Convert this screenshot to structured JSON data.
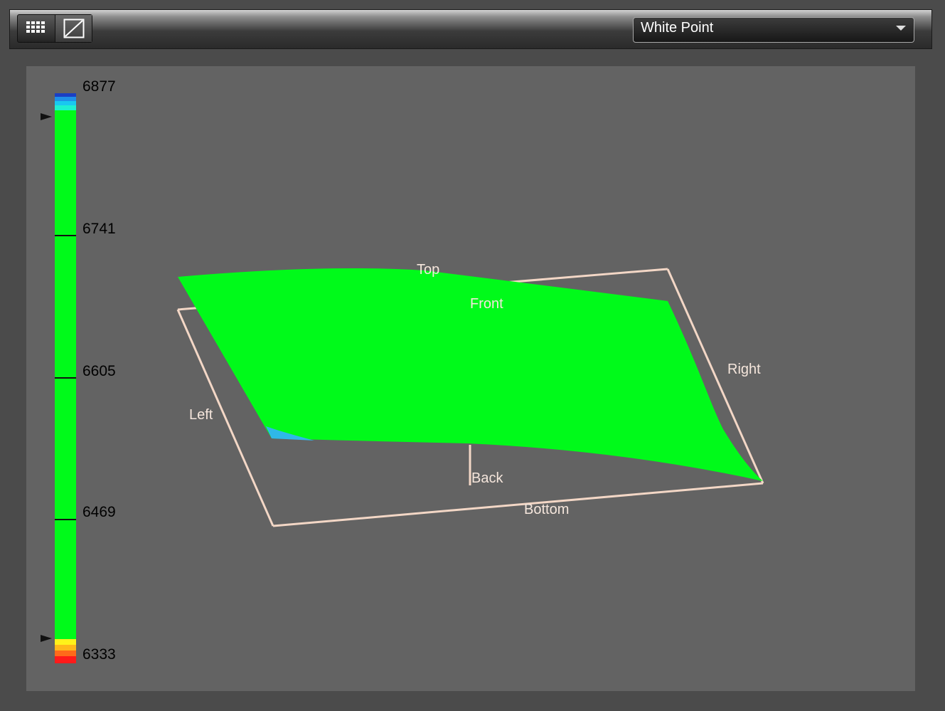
{
  "toolbar": {
    "view_buttons": [
      {
        "name": "grid-view",
        "icon": "grid-icon",
        "active": false
      },
      {
        "name": "curve-view",
        "icon": "diagonal-curve-icon",
        "active": true
      }
    ],
    "dropdown": {
      "selected": "White Point",
      "icon": "chevron-down-icon"
    }
  },
  "colorbar": {
    "labels": [
      "6877",
      "6741",
      "6605",
      "6469",
      "6333"
    ],
    "range": [
      6333,
      6877
    ],
    "colors": {
      "high": [
        "#1a3fc4",
        "#1f8fe8",
        "#19c8f0",
        "#1ef0d0"
      ],
      "mid": "#00fa1a",
      "low": [
        "#fff21a",
        "#ffb81a",
        "#ff6a1a",
        "#ff1a1a"
      ]
    }
  },
  "plot": {
    "axis_labels": {
      "top": "Top",
      "front": "Front",
      "right": "Right",
      "left": "Left",
      "back": "Back",
      "bottom": "Bottom"
    },
    "surface_color": "#00fa1a",
    "frame_color": "#f3d7c6"
  }
}
